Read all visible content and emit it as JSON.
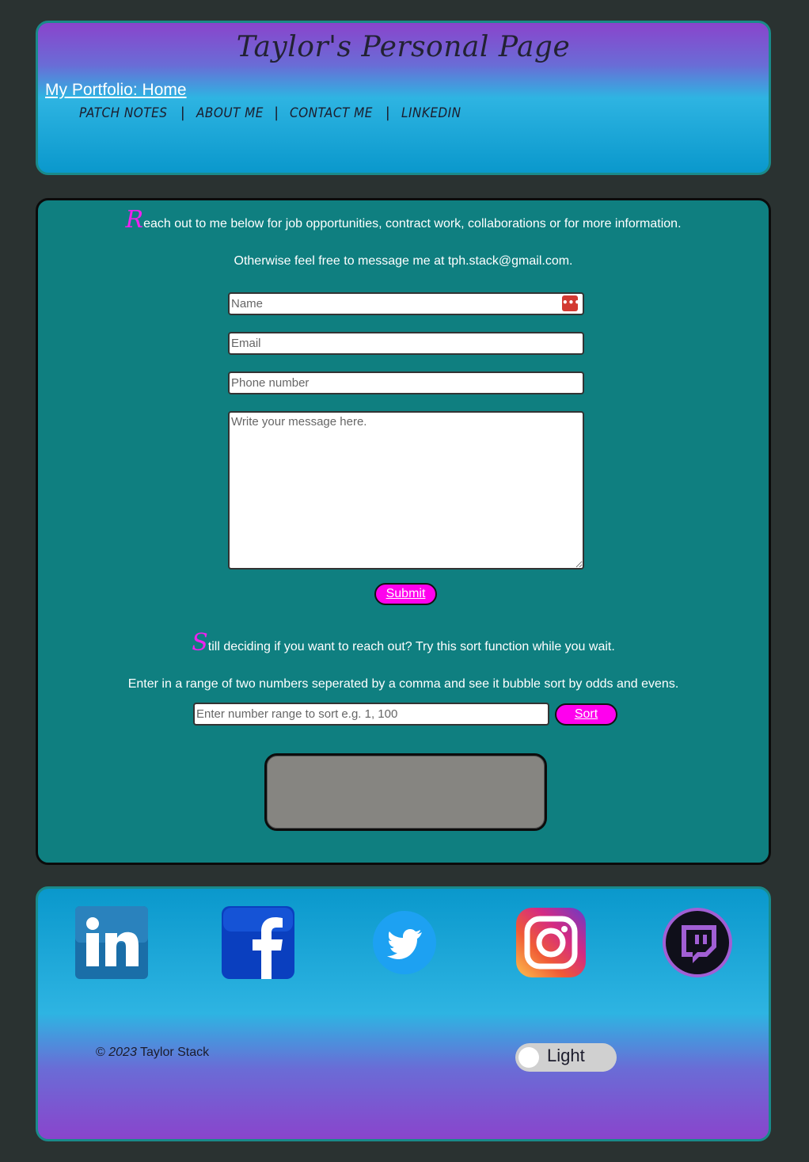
{
  "header": {
    "title": "Taylor's Personal Page",
    "home_link": "My Portfolio: Home",
    "nav": [
      {
        "label": "PATCH NOTES"
      },
      {
        "label": "ABOUT ME"
      },
      {
        "label": "CONTACT ME"
      },
      {
        "label": "LINKEDIN"
      }
    ],
    "separator": "|"
  },
  "contact": {
    "intro_cap": "R",
    "intro_rest": "each out to me below for job opportunities, contract work, collaborations or for more information.",
    "email_line": "Otherwise feel free to message me at tph.stack@gmail.com.",
    "name_placeholder": "Name",
    "email_placeholder": "Email",
    "phone_placeholder": "Phone number",
    "message_placeholder": "Write your message here.",
    "submit_label": "Submit"
  },
  "sorter": {
    "intro_cap": "S",
    "intro_rest": "till deciding if you want to reach out? Try this sort function while you wait.",
    "instructions": "Enter in a range of two numbers seperated by a comma and see it bubble sort by odds and evens.",
    "input_placeholder": "Enter number range to sort e.g. 1, 100",
    "sort_label": "Sort"
  },
  "footer": {
    "social": [
      {
        "icon": "linkedin-icon"
      },
      {
        "icon": "facebook-icon"
      },
      {
        "icon": "twitter-icon"
      },
      {
        "icon": "instagram-icon"
      },
      {
        "icon": "twitch-icon"
      }
    ],
    "copyright_symbol": "©",
    "copyright_year": "2023",
    "copyright_name": "Taylor Stack",
    "theme_toggle_label": "Light"
  },
  "colors": {
    "accent": "#ff00ee",
    "panel": "#0f7f80",
    "background": "#2a3231"
  }
}
